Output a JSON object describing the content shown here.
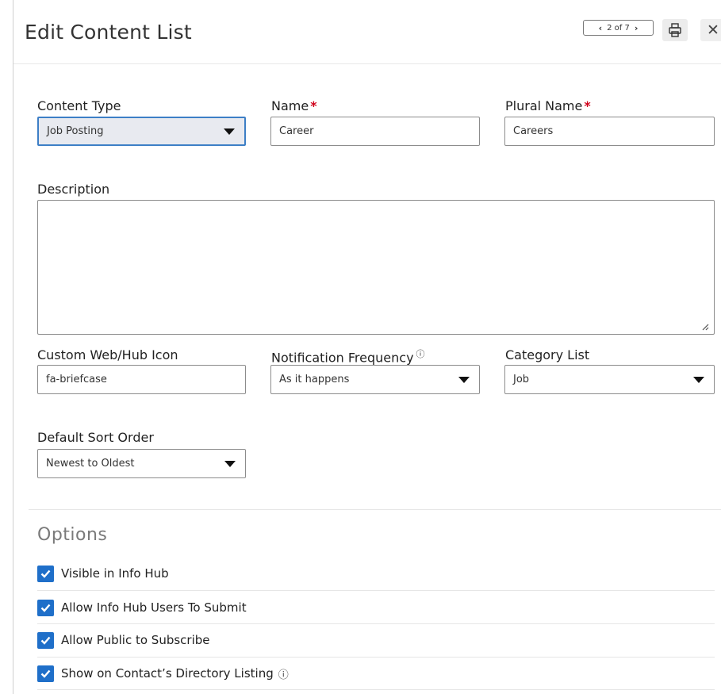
{
  "header": {
    "title": "Edit Content List",
    "pager": {
      "prev_icon": "‹",
      "label": "2 of 7",
      "next_icon": "›"
    },
    "close_icon": "✕"
  },
  "form": {
    "content_type": {
      "label": "Content Type",
      "value": "Job Posting"
    },
    "name": {
      "label": "Name",
      "required_mark": "*",
      "value": "Career"
    },
    "plural_name": {
      "label": "Plural Name",
      "required_mark": "*",
      "value": "Careers"
    },
    "description": {
      "label": "Description",
      "value": ""
    },
    "custom_icon": {
      "label": "Custom Web/Hub Icon",
      "value": "fa-briefcase"
    },
    "notification_frequency": {
      "label": "Notification Frequency",
      "info_icon": "ⓘ",
      "value": "As it happens"
    },
    "category_list": {
      "label": "Category List",
      "value": "Job"
    },
    "default_sort_order": {
      "label": "Default Sort Order",
      "value": "Newest to Oldest"
    }
  },
  "options": {
    "title": "Options",
    "items": [
      {
        "label": "Visible in Info Hub",
        "checked": true
      },
      {
        "label": "Allow Info Hub Users To Submit",
        "checked": true
      },
      {
        "label": "Allow Public to Subscribe",
        "checked": true
      },
      {
        "label": "Show on Contact’s Directory Listing",
        "checked": true,
        "info_icon": "ⓘ"
      }
    ]
  },
  "colors": {
    "accent": "#1f6fc9",
    "required": "#d0021b",
    "focus_border": "#3d7fc6"
  }
}
